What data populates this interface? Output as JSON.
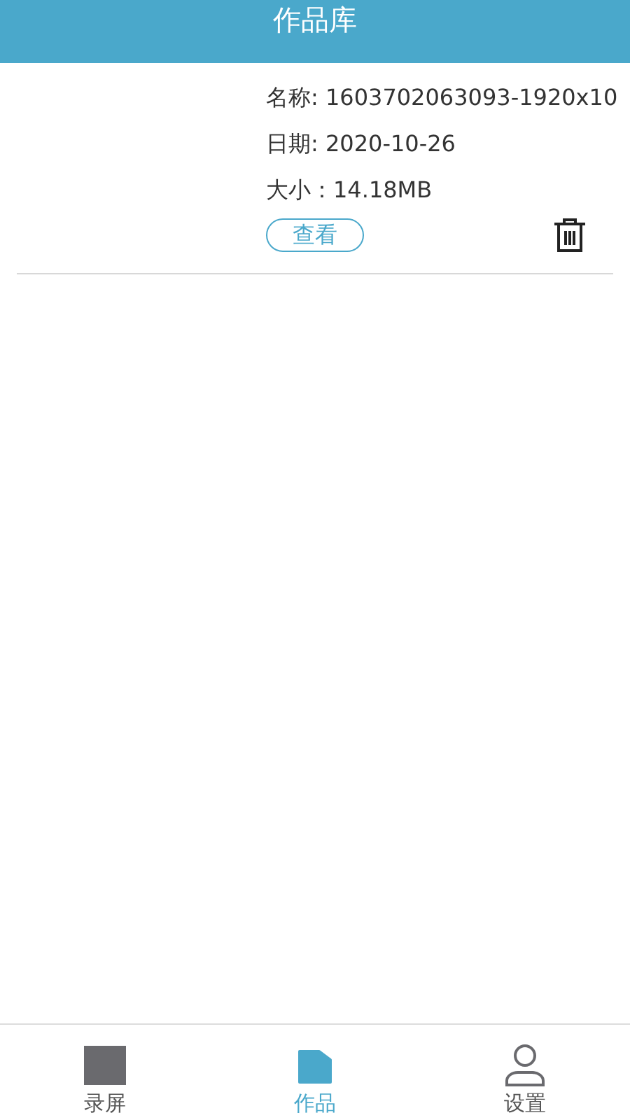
{
  "header": {
    "title": "作品库"
  },
  "works": [
    {
      "name": "名称: 1603702063093-1920x10",
      "date": "日期: 2020-10-26",
      "size": "大小：14.18MB",
      "view_button": "查看"
    }
  ],
  "tabs": [
    {
      "label": "录屏",
      "kind": "record",
      "selected": false
    },
    {
      "label": "作品",
      "kind": "works",
      "selected": true
    },
    {
      "label": "设置",
      "kind": "settings",
      "selected": false
    }
  ]
}
